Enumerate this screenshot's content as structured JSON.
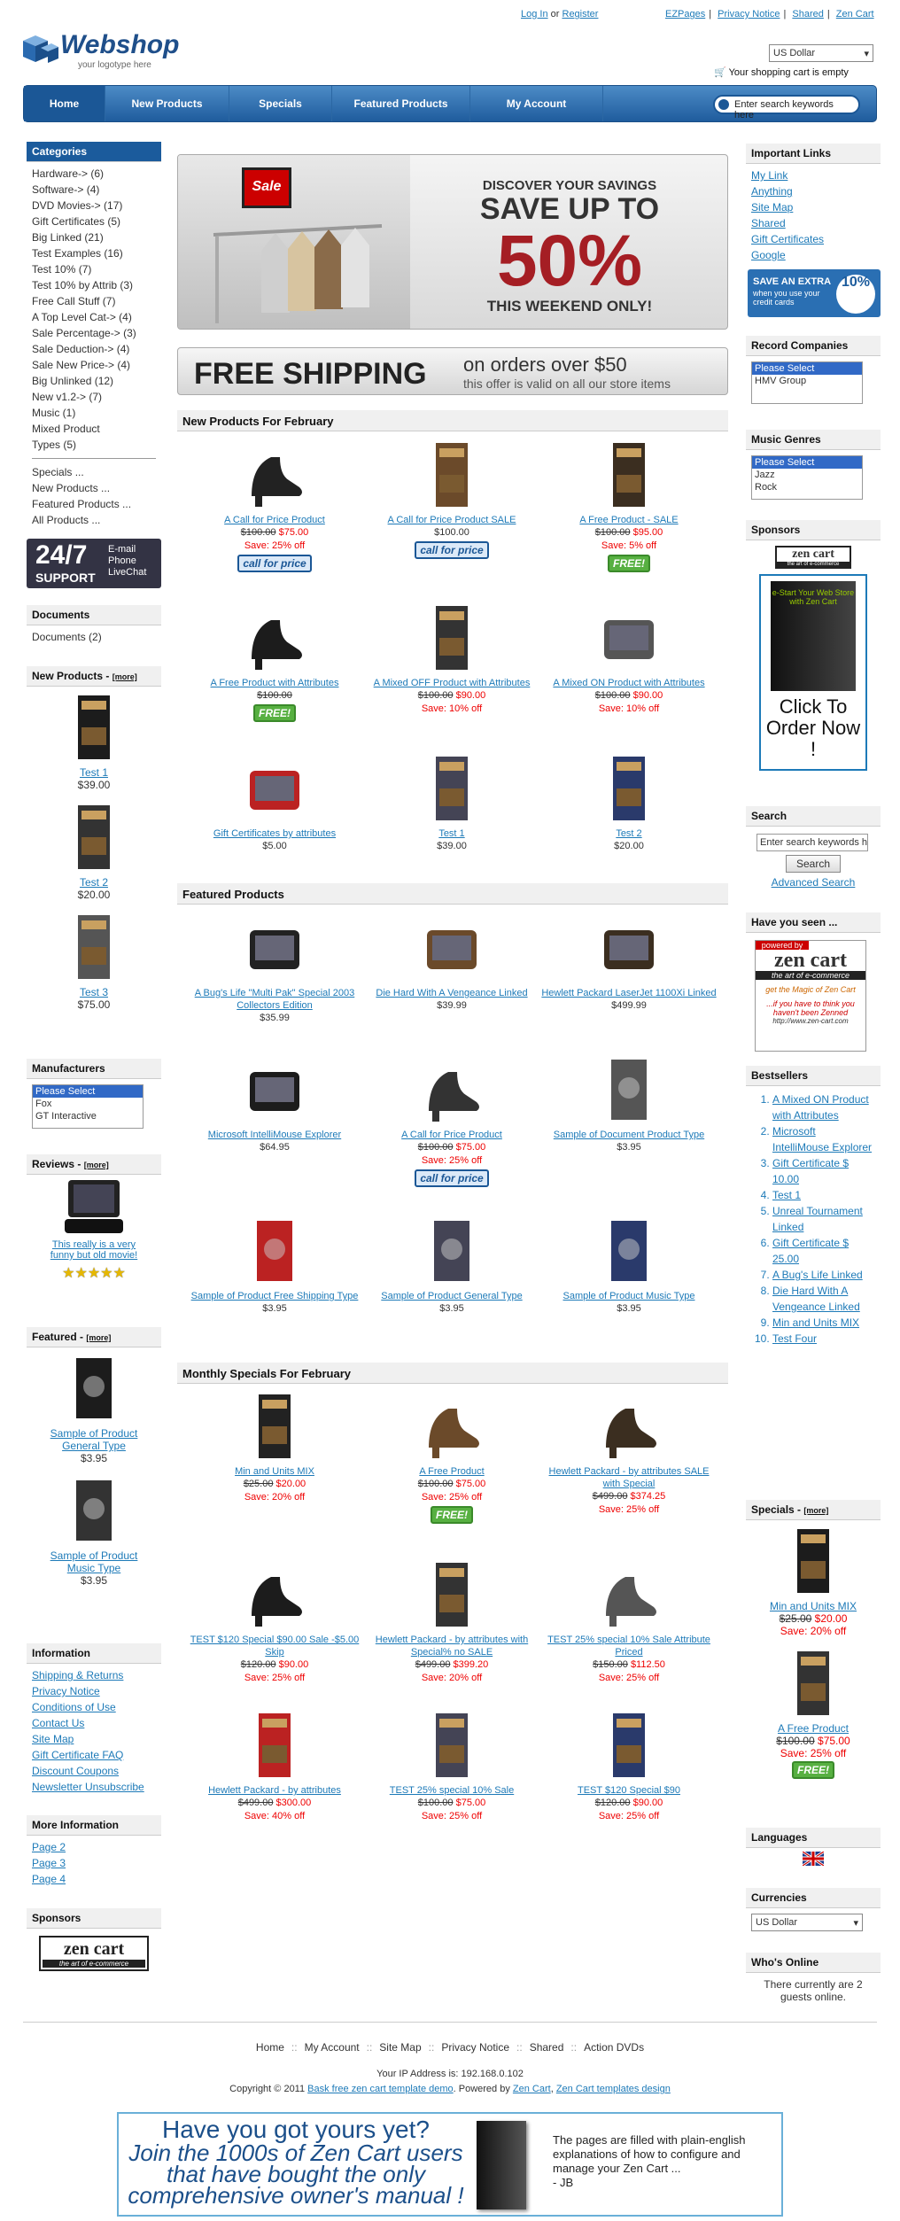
{
  "header": {
    "login": "Log In",
    "or": "or",
    "register": "Register",
    "ezpages": "EZPages",
    "privacy": "Privacy Notice",
    "shared": "Shared",
    "zencart": "Zen Cart",
    "logo_word": "Webshop",
    "logo_tag": "your logotype here",
    "currency": "US Dollar",
    "cart": "Your shopping cart is empty"
  },
  "nav": {
    "items": [
      "Home",
      "New Products",
      "Specials",
      "Featured Products",
      "My Account"
    ],
    "search_placeholder": "Enter search keywords here"
  },
  "banner": {
    "sale_sign": "Sale",
    "line1": "DISCOVER YOUR SAVINGS",
    "line2": "SAVE UP TO",
    "line3": "50%",
    "line4": "THIS WEEKEND ONLY!"
  },
  "shipping": {
    "big": "FREE SHIPPING",
    "mid": "on orders over $50",
    "small": "this offer is valid on all our store items"
  },
  "categories": {
    "title": "Categories",
    "items": [
      "Hardware-> (6)",
      "Software-> (4)",
      "DVD Movies-> (17)",
      "Gift Certificates (5)",
      "Big Linked (21)",
      "Test Examples (16)",
      "Test 10% (7)",
      "Test 10% by Attrib (3)",
      "Free Call Stuff (7)",
      "A Top Level Cat-> (4)",
      "Sale Percentage-> (3)",
      "Sale Deduction-> (4)",
      "Sale New Price-> (4)",
      "Big Unlinked (12)",
      "New v1.2-> (7)",
      "Music (1)",
      "Mixed Product",
      "Types (5)"
    ],
    "extra": [
      "Specials ...",
      "New Products ...",
      "Featured Products ...",
      "All Products ..."
    ]
  },
  "support": {
    "big": "24/7",
    "small": "SUPPORT",
    "lines": [
      "E-mail",
      "Phone",
      "LiveChat"
    ]
  },
  "documents": {
    "title": "Documents",
    "item": "Documents (2)"
  },
  "new_side": {
    "title": "New Products -",
    "more": "[more]",
    "items": [
      {
        "name": "Test 1",
        "price": "$39.00"
      },
      {
        "name": "Test 2",
        "price": "$20.00"
      },
      {
        "name": "Test 3",
        "price": "$75.00"
      }
    ]
  },
  "manufacturers": {
    "title": "Manufacturers",
    "options": [
      "Please Select",
      "Fox",
      "GT Interactive"
    ]
  },
  "reviews": {
    "title": "Reviews -",
    "more": "[more]",
    "text": "This really is a very funny but old movie!",
    "stars": "★★★★★"
  },
  "featured_side": {
    "title": "Featured -",
    "more": "[more]",
    "items": [
      {
        "name": "Sample of Product General Type",
        "price": "$3.95"
      },
      {
        "name": "Sample of Product Music Type",
        "price": "$3.95"
      }
    ]
  },
  "information": {
    "title": "Information",
    "items": [
      "Shipping & Returns",
      "Privacy Notice",
      "Conditions of Use",
      "Contact Us",
      "Site Map",
      "Gift Certificate FAQ",
      "Discount Coupons",
      "Newsletter Unsubscribe"
    ]
  },
  "more_info": {
    "title": "More Information",
    "items": [
      "Page 2",
      "Page 3",
      "Page 4"
    ]
  },
  "sponsors": {
    "title": "Sponsors",
    "logo": "zen cart",
    "logo_sub": "the art of e-commerce"
  },
  "new_products": {
    "title": "New Products For February",
    "items": [
      {
        "name": "A Call for Price Product",
        "old": "$100.00",
        "now": "$75.00",
        "save": "Save: 25% off",
        "badge": "call for price"
      },
      {
        "name": "A Call for Price Product SALE",
        "price": "$100.00",
        "badge": "call for price"
      },
      {
        "name": "A Free Product - SALE",
        "old": "$100.00",
        "now": "$95.00",
        "save": "Save: 5% off",
        "badge": "FREE!"
      },
      {
        "name": "A Free Product with Attributes",
        "old": "$100.00",
        "badge": "FREE!"
      },
      {
        "name": "A Mixed OFF Product with Attributes",
        "old": "$100.00",
        "now": "$90.00",
        "save": "Save: 10% off"
      },
      {
        "name": "A Mixed ON Product with Attributes",
        "old": "$100.00",
        "now": "$90.00",
        "save": "Save: 10% off"
      },
      {
        "name": "Gift Certificates by attributes",
        "price": "$5.00"
      },
      {
        "name": "Test 1",
        "price": "$39.00"
      },
      {
        "name": "Test 2",
        "price": "$20.00"
      }
    ]
  },
  "featured": {
    "title": "Featured Products",
    "items": [
      {
        "name": "A Bug's Life \"Multi Pak\" Special 2003 Collectors Edition",
        "price": "$35.99"
      },
      {
        "name": "Die Hard With A Vengeance Linked",
        "price": "$39.99"
      },
      {
        "name": "Hewlett Packard LaserJet 1100Xi Linked",
        "price": "$499.99"
      },
      {
        "name": "Microsoft IntelliMouse Explorer",
        "price": "$64.95"
      },
      {
        "name": "A Call for Price Product",
        "old": "$100.00",
        "now": "$75.00",
        "save": "Save: 25% off",
        "badge": "call for price"
      },
      {
        "name": "Sample of Document Product Type",
        "price": "$3.95"
      },
      {
        "name": "Sample of Product Free Shipping Type",
        "price": "$3.95"
      },
      {
        "name": "Sample of Product General Type",
        "price": "$3.95"
      },
      {
        "name": "Sample of Product Music Type",
        "price": "$3.95"
      }
    ]
  },
  "specials": {
    "title": "Monthly Specials For February",
    "items": [
      {
        "name": "Min and Units MIX",
        "old": "$25.00",
        "now": "$20.00",
        "save": "Save: 20% off"
      },
      {
        "name": "A Free Product",
        "old": "$100.00",
        "now": "$75.00",
        "save": "Save: 25% off",
        "badge": "FREE!"
      },
      {
        "name": "Hewlett Packard - by attributes SALE with Special",
        "old": "$499.00",
        "now": "$374.25",
        "save": "Save: 25% off"
      },
      {
        "name": "TEST $120 Special $90.00 Sale -$5.00 Skip",
        "old": "$120.00",
        "now": "$90.00",
        "save": "Save: 25% off"
      },
      {
        "name": "Hewlett Packard - by attributes with Special% no SALE",
        "old": "$499.00",
        "now": "$399.20",
        "save": "Save: 20% off"
      },
      {
        "name": "TEST 25% special 10% Sale Attribute Priced",
        "old": "$150.00",
        "now": "$112.50",
        "save": "Save: 25% off"
      },
      {
        "name": "Hewlett Packard - by attributes",
        "old": "$499.00",
        "now": "$300.00",
        "save": "Save: 40% off"
      },
      {
        "name": "TEST 25% special 10% Sale",
        "old": "$100.00",
        "now": "$75.00",
        "save": "Save: 25% off"
      },
      {
        "name": "TEST $120 Special $90",
        "old": "$120.00",
        "now": "$90.00",
        "save": "Save: 25% off"
      }
    ]
  },
  "important": {
    "title": "Important Links",
    "items": [
      "My Link",
      "Anything",
      "Site Map",
      "Shared",
      "Gift Certificates",
      "Google"
    ]
  },
  "extra_banner": {
    "l1": "SAVE AN EXTRA",
    "l2": "when you use your credit cards",
    "pct": "10%"
  },
  "record": {
    "title": "Record Companies",
    "options": [
      "Please Select",
      "HMV Group"
    ]
  },
  "genres": {
    "title": "Music Genres",
    "options": [
      "Please Select",
      "Jazz",
      "Rock"
    ]
  },
  "sponsors_r": {
    "title": "Sponsors",
    "logo": "zen cart",
    "logo_sub": "the art of e-commerce",
    "book": "e-Start Your Web Store with Zen Cart",
    "order": "Click To Order Now !"
  },
  "search_r": {
    "title": "Search",
    "placeholder": "Enter search keywords here",
    "button": "Search",
    "adv": "Advanced Search"
  },
  "seen": {
    "title": "Have you seen ...",
    "powered": "powered by",
    "logo": "zen cart",
    "sub": "the art of e-commerce",
    "magic": "get the Magic of Zen Cart",
    "think": "...if you have to think you haven't been Zenned",
    "url": "http://www.zen-cart.com"
  },
  "bestsellers": {
    "title": "Bestsellers",
    "items": [
      "A Mixed ON Product with Attributes",
      "Microsoft IntelliMouse Explorer",
      "Gift Certificate $ 10.00",
      "Test 1",
      "Unreal Tournament Linked",
      "Gift Certificate $ 25.00",
      "A Bug's Life Linked",
      "Die Hard With A Vengeance Linked",
      "Min and Units MIX",
      "Test Four"
    ]
  },
  "specials_side": {
    "title": "Specials -",
    "more": "[more]",
    "items": [
      {
        "name": "Min and Units MIX",
        "old": "$25.00",
        "now": "$20.00",
        "save": "Save: 20% off"
      },
      {
        "name": "A Free Product",
        "old": "$100.00",
        "now": "$75.00",
        "save": "Save: 25% off",
        "badge": "FREE!"
      }
    ]
  },
  "languages": {
    "title": "Languages"
  },
  "currencies": {
    "title": "Currencies",
    "value": "US Dollar"
  },
  "online": {
    "title": "Who's Online",
    "text": "There currently are 2 guests online."
  },
  "footer": {
    "links": [
      "Home",
      "My Account",
      "Site Map",
      "Privacy Notice",
      "Shared",
      "Action DVDs"
    ],
    "ip": "Your IP Address is: 192.168.0.102",
    "copy": "Copyright © 2011",
    "l1": "Bask free zen cart template demo",
    "pw": ". Powered by",
    "l2": "Zen Cart",
    "l3": "Zen Cart templates design"
  },
  "promo": {
    "h1": "Have you got yours yet?",
    "h2": "Join the 1000s of Zen Cart users that have bought the only comprehensive owner's manual !",
    "right": "The pages are filled with plain-english explanations of how to configure and manage your Zen Cart ...",
    "sig": "- JB"
  },
  "colors": {
    "brand": "#1b5b9c",
    "link": "#1d7ab8",
    "sale": "#e00000"
  }
}
